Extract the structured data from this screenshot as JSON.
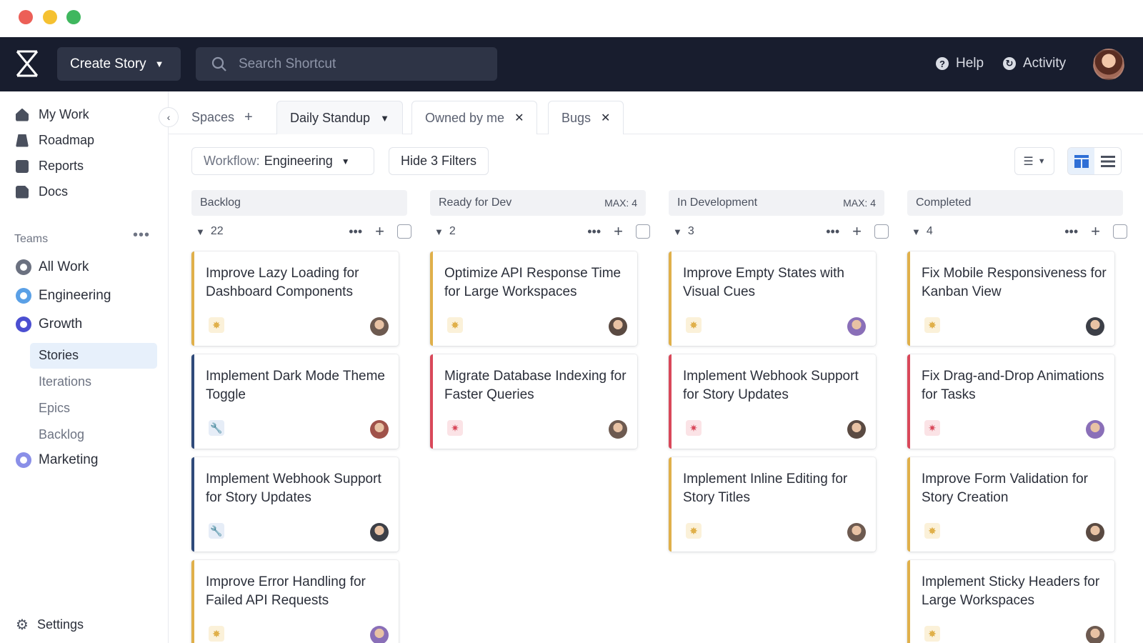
{
  "window": {
    "traffic_lights": [
      "close",
      "minimize",
      "maximize"
    ]
  },
  "topbar": {
    "create_label": "Create Story",
    "search_placeholder": "Search Shortcut",
    "help_label": "Help",
    "activity_label": "Activity"
  },
  "sidebar": {
    "nav": [
      {
        "label": "My Work",
        "icon": "home-icon"
      },
      {
        "label": "Roadmap",
        "icon": "roadmap-icon"
      },
      {
        "label": "Reports",
        "icon": "reports-icon"
      },
      {
        "label": "Docs",
        "icon": "docs-icon"
      }
    ],
    "teams_label": "Teams",
    "teams": [
      {
        "label": "All Work",
        "color": "#6b7180"
      },
      {
        "label": "Engineering",
        "color": "#5aa0e6"
      },
      {
        "label": "Growth",
        "color": "#4b4fd1"
      },
      {
        "label": "Marketing",
        "color": "#8a8fe8"
      }
    ],
    "growth_sub": [
      {
        "label": "Stories",
        "active": true
      },
      {
        "label": "Iterations",
        "active": false
      },
      {
        "label": "Epics",
        "active": false
      },
      {
        "label": "Backlog",
        "active": false
      }
    ],
    "settings_label": "Settings"
  },
  "tabs": [
    {
      "label": "Spaces",
      "action": "+"
    },
    {
      "label": "Daily Standup",
      "action": "⌄"
    },
    {
      "label": "Owned by me",
      "action": "×"
    },
    {
      "label": "Bugs",
      "action": "×"
    }
  ],
  "filters": {
    "workflow_label": "Workflow:",
    "workflow_value": "Engineering",
    "hide_filters": "Hide 3 Filters"
  },
  "columns": [
    {
      "name": "Backlog",
      "max": "",
      "count": "22",
      "cards": [
        {
          "title": "Improve Lazy Loading for Dashboard Components",
          "type": "feature"
        },
        {
          "title": "Implement Dark Mode Theme Toggle",
          "type": "chore"
        },
        {
          "title": "Implement Webhook Support for Story Updates",
          "type": "chore"
        },
        {
          "title": "Improve Error Handling for Failed API Requests",
          "type": "feature"
        }
      ]
    },
    {
      "name": "Ready for Dev",
      "max": "MAX: 4",
      "count": "2",
      "cards": [
        {
          "title": "Optimize API Response Time for Large Workspaces",
          "type": "feature"
        },
        {
          "title": "Migrate Database Indexing for Faster Queries",
          "type": "bug"
        }
      ]
    },
    {
      "name": "In Development",
      "max": "MAX: 4",
      "count": "3",
      "cards": [
        {
          "title": "Improve Empty States with Visual Cues",
          "type": "feature"
        },
        {
          "title": "Implement Webhook Support for Story Updates",
          "type": "bug"
        },
        {
          "title": "Implement Inline Editing for Story Titles",
          "type": "feature"
        }
      ]
    },
    {
      "name": "Completed",
      "max": "",
      "count": "4",
      "cards": [
        {
          "title": "Fix Mobile Responsiveness for Kanban View",
          "type": "feature"
        },
        {
          "title": "Fix Drag-and-Drop Animations for Tasks",
          "type": "bug"
        },
        {
          "title": "Improve Form Validation for Story Creation",
          "type": "feature"
        },
        {
          "title": "Implement Sticky Headers for Large Workspaces",
          "type": "feature"
        }
      ]
    }
  ],
  "colors": {
    "topbar_bg": "#181d2e",
    "feature": "#e0b04a",
    "bug": "#d9485a",
    "chore": "#2f4a7a"
  }
}
